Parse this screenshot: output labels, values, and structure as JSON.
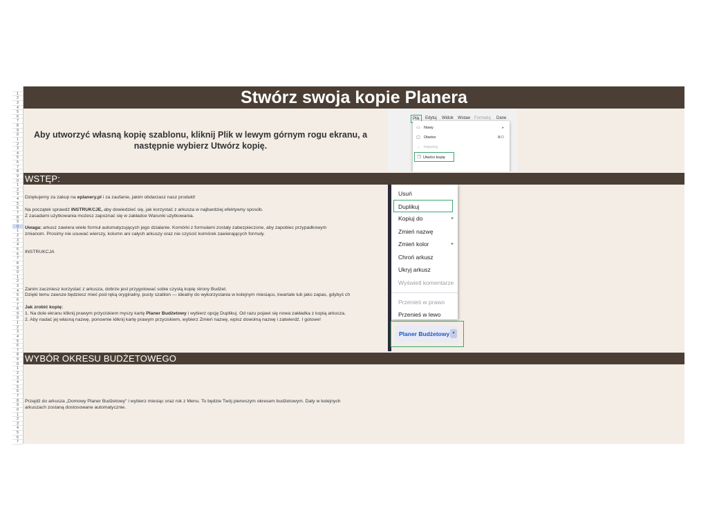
{
  "title": "Stwórz swoja kopie Planera",
  "intro": {
    "line1": "Aby utworzyć własną kopię szablonu, kliknij Plik w lewym górnym rogu ekranu, a",
    "line2": "następnie wybierz Utwórz kopię."
  },
  "file_menu_screenshot": {
    "menubar": [
      "Plik",
      "Edytuj",
      "Widok",
      "Wstaw",
      "Formatuj",
      "Dane"
    ],
    "items": [
      {
        "icon": "document-icon",
        "label": "Nowy",
        "shortcut": "▸"
      },
      {
        "icon": "folder-icon",
        "label": "Otwórz",
        "shortcut": "⌘O"
      },
      {
        "icon": "import-icon",
        "label": "Importuj",
        "shortcut": ""
      },
      {
        "icon": "copy-icon",
        "label": "Utwórz kopię",
        "shortcut": ""
      }
    ]
  },
  "sections": {
    "wstep": "WSTĘP:",
    "wybor": "WYBÓR OKRESU BUDŻETOWEGO"
  },
  "wstep_text": {
    "p1_a": "Dziękujemy za zakup na ",
    "p1_b": "eplanery.pl",
    "p1_c": " i za zaufanie, jakim obdarzasz nasz produkt!",
    "p2_a": "Na początek sprawdź ",
    "p2_b": "INSTRUKCJE,",
    "p2_c": " aby dowiedzieć się, jak korzystać z arkusza w najbardziej efektywny sposób.",
    "p3": "Z zasadami użytkowania możesz zapoznać się w zakładce Warunki użytkowania.",
    "p4_a": "Uwaga:",
    "p4_b": " arkusz zawiera wiele formuł automatyzujących jego działanie. Komórki z formułami zostały zabezpieczone, aby zapobiec przypadkowym",
    "p5": "zmianom. Prosimy nie usuwać wierszy, kolumn ani całych arkuszy oraz nie czyścić komórek zawierających formuły.",
    "p6": "INSTRUKCJA",
    "p7": "Zanim zaczniesz korzystać z arkusza, dobrze jest przygotować sobie czystą kopię strony Budżet.",
    "p8": "Dzięki temu zawsze będziesz mieć pod ręką oryginalny, pusty szablon — idealny do wykorzystania w kolejnym miesiącu, kwartale lub jako zapas, gdybyś ch",
    "p9": "Jak zrobić kopię:",
    "p10_a": "1. Na dole ekranu kliknij prawym przyciskiem myszy kartę ",
    "p10_b": "Planer Budżetowy",
    "p10_c": " i wybierz opcję Duplikuj. Od razu pojawi się nowa zakładka z kopią arkusza.",
    "p11": "2. Aby nadać jej własną nazwę, ponownie kliknij kartę prawym przyciskiem, wybierz Zmień nazwę, wpisz dowolną nazwę i zatwierdź. I gotowe!"
  },
  "context_menu_screenshot": {
    "items": [
      {
        "label": "Usuń",
        "arrow": "",
        "disabled": false
      },
      {
        "label": "Duplikuj",
        "arrow": "",
        "disabled": false
      },
      {
        "label": "Kopiuj do",
        "arrow": "▸",
        "disabled": false
      },
      {
        "label": "Zmień nazwę",
        "arrow": "",
        "disabled": false
      },
      {
        "label": "Zmień kolor",
        "arrow": "▸",
        "disabled": false
      },
      {
        "label": "Chroń arkusz",
        "arrow": "",
        "disabled": false
      },
      {
        "label": "Ukryj arkusz",
        "arrow": "",
        "disabled": false
      },
      {
        "label": "Wyświetl komentarze",
        "arrow": "",
        "disabled": true
      },
      {
        "label": "Przenieś w prawo",
        "arrow": "",
        "disabled": true
      },
      {
        "label": "Przenieś w lewo",
        "arrow": "",
        "disabled": false
      }
    ],
    "tab_label": "Planer Budżetowy",
    "tab_caret": "▾"
  },
  "wybor_text": {
    "line1": "Przejdź do arkusza „Domowy Planer Budżetowy\" i wybierz miesiąc oraz rok z Menu. To będzie Twój pierwszym okresem budżetowym. Daty w kolejnych",
    "line2": "arkuszach zostaną dostosowane automatycznie."
  },
  "row_numbers": [
    "",
    "1",
    "2",
    "3",
    "4",
    "5",
    "6",
    "7",
    "8",
    "9",
    "0",
    "1",
    "2",
    "3",
    "4",
    "5",
    "6",
    "7",
    "8",
    "9",
    "0",
    "1",
    "2",
    "3",
    "4",
    "5",
    "6",
    "7",
    "8",
    "9",
    "0",
    "1",
    "2",
    "3",
    "4",
    "5",
    "6",
    "7",
    "8",
    "9",
    "0",
    "1",
    "2",
    "3",
    "4",
    "5",
    "6",
    "7",
    "8",
    "9",
    "0",
    "1",
    "2",
    "3",
    "4",
    "5",
    "6",
    "7",
    "8",
    "9",
    "0",
    "1",
    "2",
    "3",
    "4",
    "5",
    "6",
    "7",
    "8",
    "9",
    "0",
    "1",
    "2",
    "3",
    "4",
    "5",
    "6",
    "7"
  ],
  "colors": {
    "band": "#4b3f35",
    "background": "#f3ede6",
    "highlight_green": "#3aa76d",
    "tab_blue": "#1a56c4"
  }
}
